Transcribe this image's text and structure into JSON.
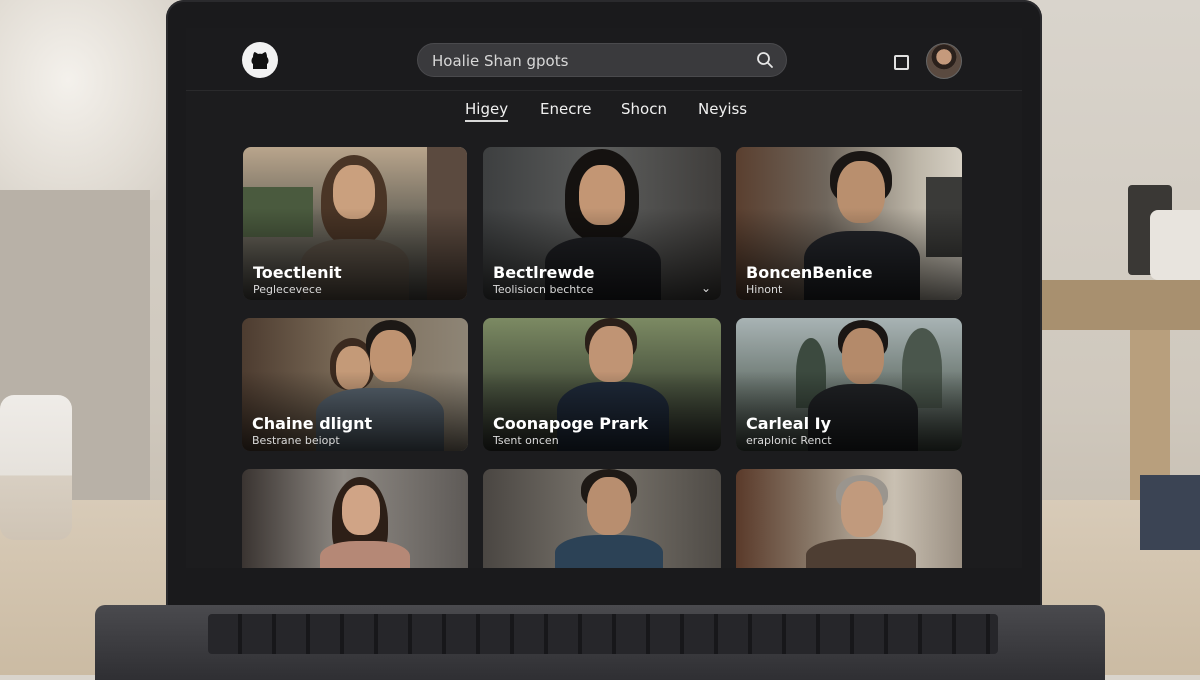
{
  "header": {
    "search_text": "Hoalie Shan gpots",
    "logo_icon": "github-icon",
    "search_icon": "search-icon",
    "square_icon": "square-icon"
  },
  "tabs": [
    {
      "label": "Higey",
      "active": true
    },
    {
      "label": "Enecre",
      "active": false
    },
    {
      "label": "Shocn",
      "active": false
    },
    {
      "label": "Neyiss",
      "active": false
    }
  ],
  "cards": [
    {
      "name": "Toectlenit",
      "subtitle": "Peglecevece"
    },
    {
      "name": "Bectlrewde",
      "subtitle": "Teolisiocn bechtce"
    },
    {
      "name": "BoncenBenice",
      "subtitle": "Hinont"
    },
    {
      "name": "Chaine dlignt",
      "subtitle": "Bestrane beiopt"
    },
    {
      "name": "Coonapoge Prark",
      "subtitle": "Tsent oncen"
    },
    {
      "name": "Carleal Iy",
      "subtitle": "eraplonic Renct"
    },
    {
      "name": "",
      "subtitle": ""
    },
    {
      "name": "",
      "subtitle": ""
    },
    {
      "name": "",
      "subtitle": ""
    }
  ]
}
